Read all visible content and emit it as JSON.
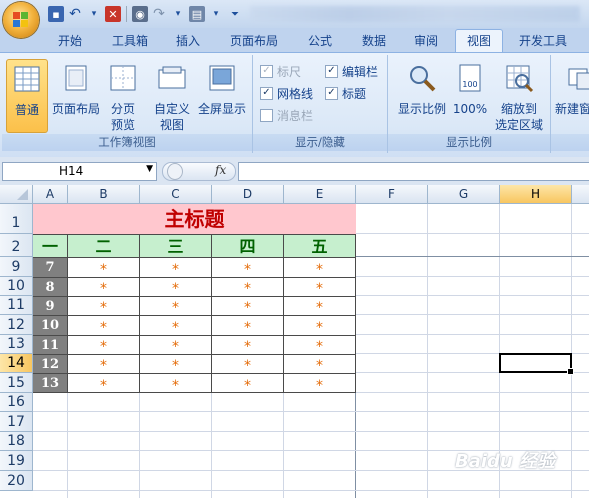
{
  "quick_access": {
    "icons": [
      "save-icon",
      "undo-icon",
      "close-icon",
      "camera-icon",
      "redo-icon",
      "format-icon",
      "more-icon"
    ]
  },
  "tabs": [
    "开始",
    "工具箱",
    "插入",
    "页面布局",
    "公式",
    "数据",
    "审阅",
    "视图",
    "开发工具"
  ],
  "active_tab": "视图",
  "ribbon": {
    "group_workbook_views": {
      "label": "工作簿视图",
      "normal": "普通",
      "page_layout": "页面布局",
      "page_break_1": "分页",
      "page_break_2": "预览",
      "custom_1": "自定义",
      "custom_2": "视图",
      "fullscreen": "全屏显示"
    },
    "group_show_hide": {
      "label": "显示/隐藏",
      "ruler": "标尺",
      "formula_bar": "编辑栏",
      "gridlines": "网格线",
      "headings": "标题",
      "message_bar": "消息栏"
    },
    "group_zoom": {
      "label": "显示比例",
      "zoom": "显示比例",
      "hundred": "100%",
      "zoom_sel_1": "缩放到",
      "zoom_sel_2": "选定区域",
      "icon_100_text": "100"
    },
    "group_window": {
      "new_window": "新建窗"
    }
  },
  "formula_bar": {
    "name_box": "H14",
    "fx": "fx",
    "content": ""
  },
  "sheet": {
    "columns": [
      "A",
      "B",
      "C",
      "D",
      "E",
      "F",
      "G",
      "H"
    ],
    "selected_column": "H",
    "rows": [
      "1",
      "2",
      "9",
      "10",
      "11",
      "12",
      "13",
      "14",
      "15",
      "16",
      "17",
      "18",
      "19",
      "20"
    ],
    "selected_row": "14",
    "title": "主标题",
    "headers": [
      "一",
      "二",
      "三",
      "四",
      "五"
    ],
    "data_rows": [
      {
        "a": "7",
        "vals": [
          "*",
          "*",
          "*",
          "*"
        ]
      },
      {
        "a": "8",
        "vals": [
          "*",
          "*",
          "*",
          "*"
        ]
      },
      {
        "a": "9",
        "vals": [
          "*",
          "*",
          "*",
          "*"
        ]
      },
      {
        "a": "10",
        "vals": [
          "*",
          "*",
          "*",
          "*"
        ]
      },
      {
        "a": "11",
        "vals": [
          "*",
          "*",
          "*",
          "*"
        ]
      },
      {
        "a": "12",
        "vals": [
          "*",
          "*",
          "*",
          "*"
        ]
      },
      {
        "a": "13",
        "vals": [
          "*",
          "*",
          "*",
          "*"
        ]
      }
    ]
  },
  "watermark": "Baidu 经验",
  "colors": {
    "title_bg": "#ffc7ce",
    "title_text": "#c00000",
    "header_bg": "#c6efce",
    "header_text": "#006100",
    "id_bg": "#808080",
    "star": "#e46c0a",
    "active_tab": "#ecf3fc",
    "selected_header": "#f8c660"
  }
}
